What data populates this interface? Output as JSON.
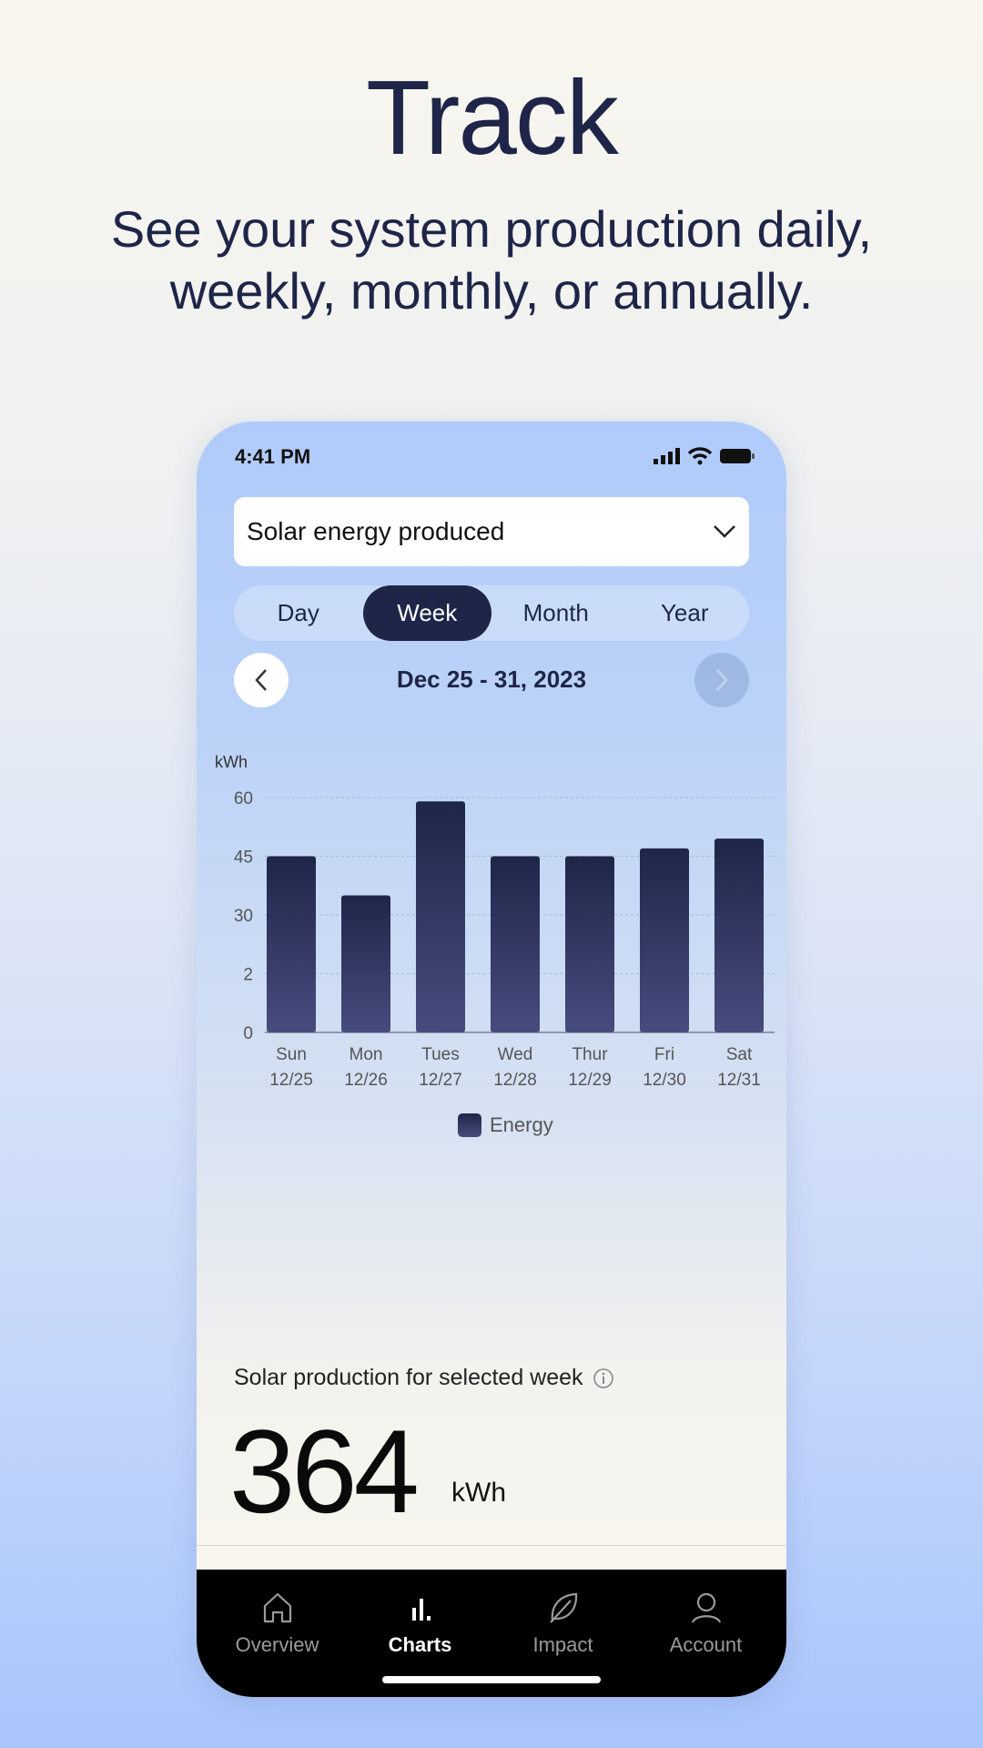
{
  "hero": {
    "title": "Track",
    "subtitle": "See your system production daily, weekly, monthly, or annually."
  },
  "status": {
    "time": "4:41 PM"
  },
  "dropdown": {
    "selected": "Solar energy produced"
  },
  "segments": [
    {
      "label": "Day"
    },
    {
      "label": "Week",
      "active": true
    },
    {
      "label": "Month"
    },
    {
      "label": "Year"
    }
  ],
  "date_range": "Dec 25 - 31, 2023",
  "chart_data": {
    "type": "bar",
    "ylabel": "kWh",
    "categories": [
      "Sun",
      "Mon",
      "Tues",
      "Wed",
      "Thur",
      "Fri",
      "Sat"
    ],
    "dates": [
      "12/25",
      "12/26",
      "12/27",
      "12/28",
      "12/29",
      "12/30",
      "12/31"
    ],
    "series": [
      {
        "name": "Energy",
        "values": [
          45,
          35,
          59,
          45,
          45,
          47,
          49.5
        ],
        "color": "#1f2548"
      }
    ],
    "yticks": [
      {
        "value": 0,
        "label": "0"
      },
      {
        "value": 15,
        "label": "2"
      },
      {
        "value": 30,
        "label": "30"
      },
      {
        "value": 45,
        "label": "45"
      },
      {
        "value": 60,
        "label": "60"
      }
    ],
    "ylim": [
      0,
      60
    ],
    "grid": true,
    "legend": "bottom"
  },
  "summary": {
    "label": "Solar production for selected week",
    "value": "364",
    "unit": "kWh"
  },
  "nav": [
    {
      "label": "Overview",
      "icon": "home-icon"
    },
    {
      "label": "Charts",
      "icon": "bar-chart-icon",
      "active": true
    },
    {
      "label": "Impact",
      "icon": "leaf-icon"
    },
    {
      "label": "Account",
      "icon": "user-icon"
    }
  ],
  "colors": {
    "navy": "#1f2548",
    "phone_top": "#b0cbfa",
    "nav_bg": "#000000"
  }
}
